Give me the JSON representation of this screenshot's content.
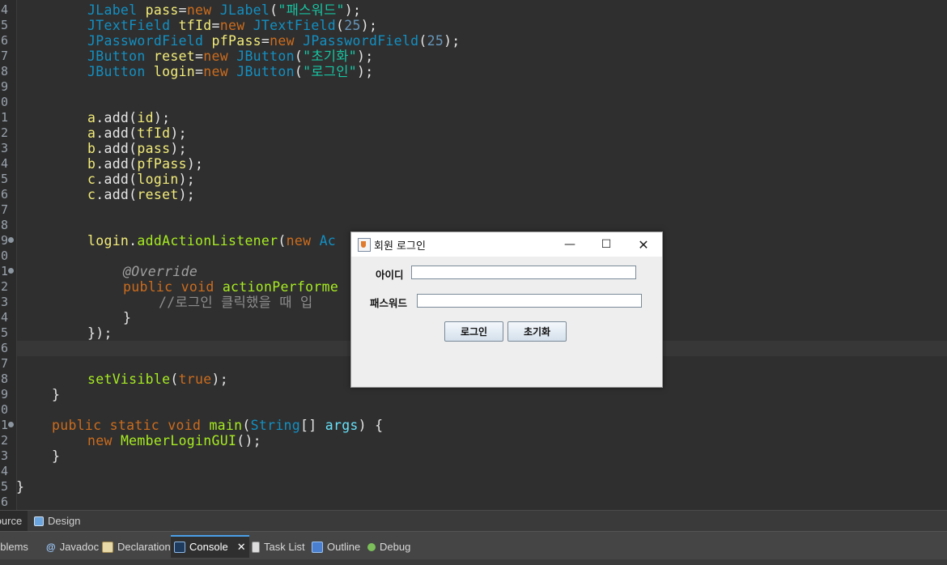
{
  "editor": {
    "gutter_numbers": [
      "4",
      "5",
      "6",
      "7",
      "8",
      "9",
      "0",
      "1",
      "2",
      "3",
      "4",
      "5",
      "6",
      "7",
      "8",
      "9",
      "0",
      "1",
      "2",
      "3",
      "4",
      "5",
      "6",
      "7",
      "8",
      "9",
      "0",
      "1",
      "2",
      "3",
      "4",
      "5",
      "6"
    ],
    "lines": {
      "l1": [
        "JLabel ",
        "pass",
        "=",
        "new ",
        "JLabel",
        "(",
        "\"패스워드\"",
        ");"
      ],
      "l2": [
        "JTextField ",
        "tfId",
        "=",
        "new ",
        "JTextField",
        "(",
        "25",
        ");"
      ],
      "l3": [
        "JPasswordField ",
        "pfPass",
        "=",
        "new ",
        "JPasswordField",
        "(",
        "25",
        ");"
      ],
      "l4": [
        "JButton ",
        "reset",
        "=",
        "new ",
        "JButton",
        "(",
        "\"초기화\"",
        ");"
      ],
      "l5": [
        "JButton ",
        "login",
        "=",
        "new ",
        "JButton",
        "(",
        "\"로그인\"",
        ");"
      ],
      "l6": [
        "a",
        ".add(",
        "id",
        ");"
      ],
      "l7": [
        "a",
        ".add(",
        "tfId",
        ");"
      ],
      "l8": [
        "b",
        ".add(",
        "pass",
        ");"
      ],
      "l9": [
        "b",
        ".add(",
        "pfPass",
        ");"
      ],
      "l10": [
        "c",
        ".add(",
        "login",
        ");"
      ],
      "l11": [
        "c",
        ".add(",
        "reset",
        ");"
      ],
      "l12": [
        "login",
        ".",
        "addActionListener",
        "(",
        "new ",
        "Ac"
      ],
      "l13": "@Override",
      "l14": [
        "public ",
        "void ",
        "actionPerforme"
      ],
      "l15": "//로그인 클릭했을 때 입",
      "l16": "}",
      "l17": "});",
      "l18": [
        "setVisible",
        "(",
        "true",
        ");"
      ],
      "l19": "}",
      "l20": [
        "public ",
        "static ",
        "void ",
        "main",
        "(",
        "String",
        "[] ",
        "args",
        ") {"
      ],
      "l21": [
        "new ",
        "MemberLoginGUI",
        "();"
      ],
      "l22": "}",
      "l23": "}"
    }
  },
  "editor_tabs": [
    {
      "label": "Source",
      "icon": "source-icon",
      "active": true
    },
    {
      "label": "Design",
      "icon": "design-icon",
      "active": false
    }
  ],
  "views": [
    {
      "label": "Problems",
      "icon": "problems-icon"
    },
    {
      "label": "Javadoc",
      "icon": "javadoc-icon"
    },
    {
      "label": "Declaration",
      "icon": "declaration-icon"
    },
    {
      "label": "Console",
      "icon": "console-icon",
      "active": true,
      "close": "✕"
    },
    {
      "label": "Task List",
      "icon": "task-list-icon"
    },
    {
      "label": "Outline",
      "icon": "outline-icon"
    },
    {
      "label": "Debug",
      "icon": "debug-icon"
    }
  ],
  "dialog": {
    "title": "회원 로그인",
    "icon": "java-icon",
    "minimize": "—",
    "maximize": "☐",
    "close": "✕",
    "id_label": "아이디",
    "id_value": "",
    "pw_label": "패스워드",
    "pw_value": "",
    "login_button": "로그인",
    "reset_button": "초기화"
  },
  "colors": {
    "keyword": "#cc6c1d",
    "type": "#1290c3",
    "string": "#17c6a3",
    "number": "#6897bb",
    "variable": "#f3ec79",
    "method": "#a7ec21",
    "editor_bg": "#2f2f2f",
    "console_accent": "#4a9fe8"
  }
}
